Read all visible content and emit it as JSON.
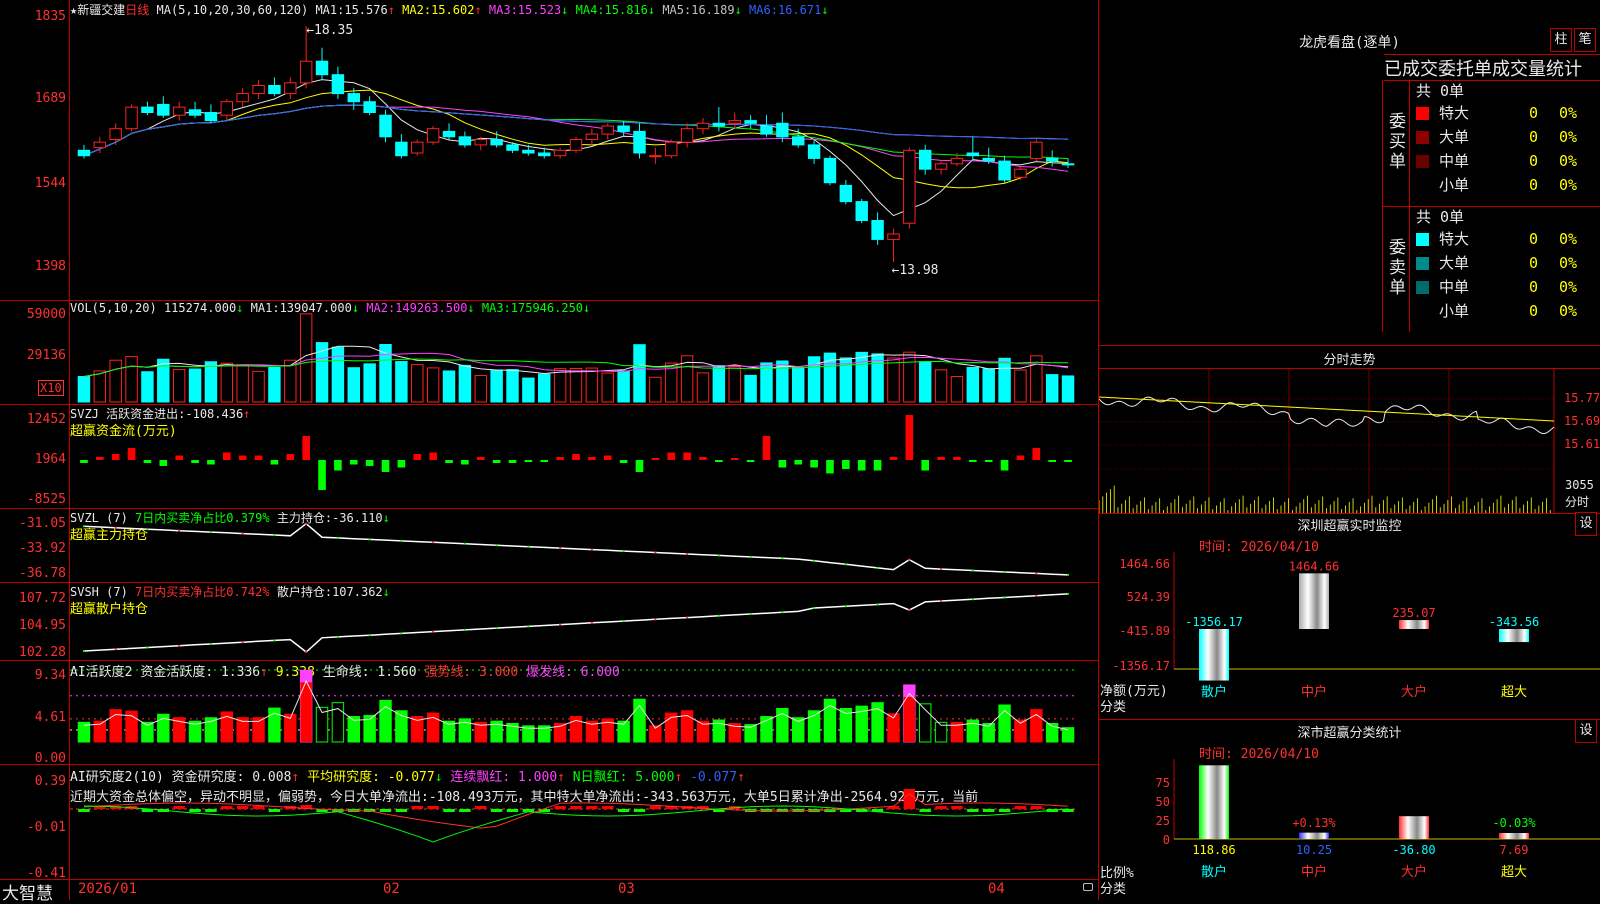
{
  "stock": {
    "star": "★",
    "name": "新疆交建",
    "period": "日线"
  },
  "colors": {
    "up": "#ff2020",
    "down": "#00ffff",
    "grid": "#c00000",
    "axis_text": "#ff3030"
  },
  "main": {
    "ma_header": "MA(5,10,20,30,60,120)",
    "ma": [
      {
        "label": "MA1:",
        "value": "15.576",
        "arrow": "↑",
        "color": "#e8e8e8"
      },
      {
        "label": "MA2:",
        "value": "15.602",
        "arrow": "↑",
        "color": "#ffff00"
      },
      {
        "label": "MA3:",
        "value": "15.523",
        "arrow": "↓",
        "color": "#ff40ff"
      },
      {
        "label": "MA4:",
        "value": "15.816",
        "arrow": "↓",
        "color": "#00ff00"
      },
      {
        "label": "MA5:",
        "value": "16.189",
        "arrow": "↓",
        "color": "#c0c0c0"
      },
      {
        "label": "MA6:",
        "value": "16.671",
        "arrow": "↓",
        "color": "#3060ff"
      }
    ],
    "yticks": [
      "1835",
      "1689",
      "1544",
      "1398"
    ],
    "high_label": "18.35",
    "low_label": "13.98"
  },
  "vol": {
    "header": "VOL(5,10,20)",
    "value": "115274.000",
    "value_arrow": "↓",
    "ma": [
      {
        "label": "MA1:",
        "value": "139047.000",
        "arrow": "↓",
        "color": "#e8e8e8"
      },
      {
        "label": "MA2:",
        "value": "149263.500",
        "arrow": "↓",
        "color": "#ff40ff"
      },
      {
        "label": "MA3:",
        "value": "175946.250",
        "arrow": "↓",
        "color": "#00ff00"
      }
    ],
    "yticks": [
      "59000",
      "29136"
    ],
    "unit": "X10"
  },
  "svzj": {
    "header": "SVZJ",
    "label": "活跃资金进出:",
    "value": "-108.436",
    "arrow": "↑",
    "subtitle": "超赢资金流(万元)",
    "yticks": [
      "12452",
      "1964",
      "-8525"
    ]
  },
  "svzl": {
    "header": "SVZL (7)",
    "ratio_label": "7日内买卖净占比0.379%",
    "label": "主力持仓:",
    "value": "-36.110",
    "arrow": "↓",
    "subtitle": "超赢主力持仓",
    "yticks": [
      "-31.05",
      "-33.92",
      "-36.78"
    ]
  },
  "svsh": {
    "header": "SVSH (7)",
    "ratio_label": "7日内买卖净占比0.742%",
    "label": "散户持仓:",
    "value": "107.362",
    "arrow": "↓",
    "subtitle": "超赢散户持仓",
    "yticks": [
      "107.72",
      "104.95",
      "102.28"
    ]
  },
  "ai_active": {
    "header": "AI活跃度2",
    "items": [
      {
        "text": "资金活跃度: 1.336",
        "arrow": "↑",
        "color": "#e8e8e8"
      },
      {
        "text": "9.338",
        "arrow": "",
        "color": "#ffff00"
      },
      {
        "text": "生命线: 1.560",
        "arrow": "",
        "color": "#e8e8e8"
      },
      {
        "text": "强势线: 3.000",
        "arrow": "",
        "color": "#ff3030"
      },
      {
        "text": "爆发线: 6.000",
        "arrow": "",
        "color": "#ff40ff"
      }
    ],
    "yticks": [
      "9.34",
      "4.61",
      "0.00"
    ]
  },
  "ai_research": {
    "header": "AI研究度2(10)",
    "items": [
      {
        "text": "资金研究度: 0.008",
        "arrow": "↑",
        "color": "#e8e8e8"
      },
      {
        "text": "平均研究度: -0.077",
        "arrow": "↓",
        "color": "#ffff00"
      },
      {
        "text": "连续飘红: 1.000",
        "arrow": "↑",
        "color": "#ff40ff"
      },
      {
        "text": "N日飘红: 5.000",
        "arrow": "↑",
        "color": "#00ff00"
      },
      {
        "text": "-0.077",
        "arrow": "↑",
        "color": "#3060ff"
      }
    ],
    "commentary": "近期大资金总体偏空，异动不明显，偏弱势，今日大单净流出:-108.493万元，其中特大单净流出:-343.563万元，大单5日累计净出-2564.922万元，当前",
    "yticks": [
      "0.39",
      "-0.01",
      "-0.41"
    ]
  },
  "xaxis": {
    "brand": "大智慧",
    "dates": [
      "2026/01",
      "02",
      "03",
      "04"
    ]
  },
  "right": {
    "lhb_title": "龙虎看盘(逐单)",
    "btn_bar": "柱",
    "btn_pen": "笔",
    "tabs": "已成交委托单成交量统计",
    "buy": {
      "vertical": "委买单",
      "total": "共 0单",
      "rows": [
        {
          "name": "特大",
          "count": "0",
          "pct": "0%",
          "color": "#ff0000"
        },
        {
          "name": "大单",
          "count": "0",
          "pct": "0%",
          "color": "#8b0000"
        },
        {
          "name": "中单",
          "count": "0",
          "pct": "0%",
          "color": "#6b0000"
        },
        {
          "name": "小单",
          "count": "0",
          "pct": "0%",
          "color": "#000000"
        }
      ]
    },
    "sell": {
      "vertical": "委卖单",
      "total": "共 0单",
      "rows": [
        {
          "name": "特大",
          "count": "0",
          "pct": "0%",
          "color": "#00ffff"
        },
        {
          "name": "大单",
          "count": "0",
          "pct": "0%",
          "color": "#008b8b"
        },
        {
          "name": "中单",
          "count": "0",
          "pct": "0%",
          "color": "#006b6b"
        },
        {
          "name": "小单",
          "count": "0",
          "pct": "0%",
          "color": "#000000"
        }
      ]
    },
    "intraday": {
      "title": "分时走势",
      "yticks": [
        "15.77",
        "15.69",
        "15.61"
      ],
      "vol_label": "3055",
      "vol_unit": "分时"
    },
    "monitor": {
      "title": "深圳超赢实时监控",
      "btn": "设",
      "time": "时间: 2026/04/10",
      "yticks": [
        "1464.66",
        "524.39",
        "-415.89",
        "-1356.17"
      ],
      "ylabel": "净额(万元)",
      "xlabel": "分类",
      "categories": [
        "散户",
        "中户",
        "大户",
        "超大"
      ],
      "values": [
        -1356.17,
        1464.66,
        235.07,
        -343.56
      ],
      "value_labels": [
        "-1356.17",
        "1464.66",
        "235.07",
        "-343.56"
      ]
    },
    "classify": {
      "title": "深市超赢分类统计",
      "btn": "设",
      "time": "时间: 2026/04/10",
      "yticks": [
        "75",
        "50",
        "25",
        "0"
      ],
      "ylabel": "比例%",
      "xlabel": "分类",
      "categories": [
        "散户",
        "中户",
        "大户",
        "超大"
      ],
      "values": [
        118.86,
        10.25,
        -36.8,
        7.69
      ],
      "value_labels": [
        "118.86",
        "10.25",
        "-36.80",
        "7.69"
      ],
      "pct_labels": [
        "",
        "+0.13%",
        "",
        "-0.03%"
      ]
    }
  },
  "chart_data": [
    {
      "type": "candlestick",
      "name_ref": "main",
      "ylim": [
        13.5,
        18.5
      ],
      "ohlc": [
        [
          16.05,
          16.15,
          15.9,
          15.95
        ],
        [
          16.1,
          16.3,
          16.0,
          16.2
        ],
        [
          16.25,
          16.55,
          16.15,
          16.45
        ],
        [
          16.45,
          16.9,
          16.4,
          16.85
        ],
        [
          16.85,
          16.95,
          16.7,
          16.75
        ],
        [
          16.9,
          17.05,
          16.65,
          16.7
        ],
        [
          16.7,
          16.95,
          16.6,
          16.85
        ],
        [
          16.8,
          16.95,
          16.65,
          16.7
        ],
        [
          16.75,
          16.9,
          16.55,
          16.6
        ],
        [
          16.7,
          17.0,
          16.6,
          16.95
        ],
        [
          16.95,
          17.2,
          16.85,
          17.1
        ],
        [
          17.1,
          17.35,
          17.0,
          17.25
        ],
        [
          17.25,
          17.4,
          17.05,
          17.1
        ],
        [
          17.1,
          17.4,
          17.0,
          17.3
        ],
        [
          17.3,
          18.35,
          17.2,
          17.7
        ],
        [
          17.7,
          17.95,
          17.35,
          17.45
        ],
        [
          17.45,
          17.6,
          17.0,
          17.1
        ],
        [
          17.1,
          17.2,
          16.8,
          16.95
        ],
        [
          16.95,
          17.05,
          16.7,
          16.75
        ],
        [
          16.7,
          16.8,
          16.2,
          16.3
        ],
        [
          16.2,
          16.35,
          15.9,
          15.95
        ],
        [
          16.0,
          16.25,
          15.95,
          16.2
        ],
        [
          16.2,
          16.5,
          16.15,
          16.45
        ],
        [
          16.4,
          16.55,
          16.25,
          16.3
        ],
        [
          16.3,
          16.4,
          16.1,
          16.15
        ],
        [
          16.15,
          16.3,
          16.05,
          16.25
        ],
        [
          16.25,
          16.4,
          16.1,
          16.15
        ],
        [
          16.15,
          16.2,
          16.0,
          16.05
        ],
        [
          16.05,
          16.15,
          15.95,
          16.0
        ],
        [
          16.0,
          16.1,
          15.9,
          15.95
        ],
        [
          15.95,
          16.1,
          15.9,
          16.05
        ],
        [
          16.05,
          16.3,
          16.0,
          16.25
        ],
        [
          16.25,
          16.45,
          16.15,
          16.35
        ],
        [
          16.35,
          16.55,
          16.25,
          16.5
        ],
        [
          16.5,
          16.6,
          16.3,
          16.4
        ],
        [
          16.4,
          16.55,
          15.9,
          16.0
        ],
        [
          15.95,
          16.1,
          15.8,
          15.95
        ],
        [
          15.95,
          16.25,
          15.9,
          16.2
        ],
        [
          16.2,
          16.55,
          16.1,
          16.45
        ],
        [
          16.45,
          16.65,
          16.35,
          16.55
        ],
        [
          16.55,
          16.85,
          16.4,
          16.5
        ],
        [
          16.55,
          16.75,
          16.45,
          16.6
        ],
        [
          16.6,
          16.7,
          16.45,
          16.55
        ],
        [
          16.5,
          16.7,
          16.3,
          16.35
        ],
        [
          16.55,
          16.75,
          16.2,
          16.3
        ],
        [
          16.3,
          16.45,
          16.1,
          16.15
        ],
        [
          16.15,
          16.25,
          15.8,
          15.9
        ],
        [
          15.9,
          15.95,
          15.4,
          15.45
        ],
        [
          15.4,
          15.5,
          15.05,
          15.1
        ],
        [
          15.1,
          15.15,
          14.7,
          14.75
        ],
        [
          14.75,
          14.9,
          14.3,
          14.4
        ],
        [
          14.4,
          14.6,
          13.98,
          14.5
        ],
        [
          14.7,
          16.1,
          14.6,
          16.05
        ],
        [
          16.05,
          16.15,
          15.6,
          15.7
        ],
        [
          15.7,
          15.85,
          15.6,
          15.8
        ],
        [
          15.8,
          16.0,
          15.75,
          15.9
        ],
        [
          16.0,
          16.3,
          15.85,
          15.95
        ],
        [
          15.9,
          16.1,
          15.8,
          15.85
        ],
        [
          15.85,
          15.95,
          15.45,
          15.5
        ],
        [
          15.55,
          15.75,
          15.5,
          15.7
        ],
        [
          15.9,
          16.25,
          15.85,
          16.2
        ],
        [
          15.9,
          16.05,
          15.75,
          15.85
        ],
        [
          15.8,
          15.9,
          15.72,
          15.78
        ]
      ]
    }
  ]
}
